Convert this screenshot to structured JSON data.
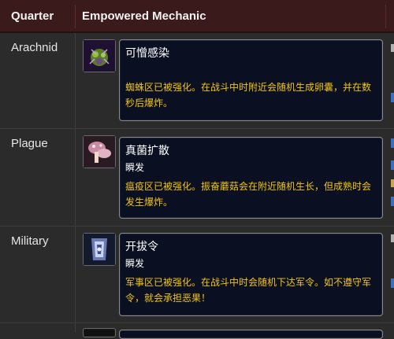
{
  "table": {
    "headers": [
      "Quarter",
      "Empowered Mechanic"
    ],
    "rows": [
      {
        "quarter": "Arachnid",
        "icon": "spider-egg-icon",
        "spell_name": "可憎感染",
        "cast_time": "",
        "description": "蜘蛛区已被强化。在战斗中时附近会随机生成卵囊，并在数秒后爆炸。"
      },
      {
        "quarter": "Plague",
        "icon": "mushroom-icon",
        "spell_name": "真菌扩散",
        "cast_time": "瞬发",
        "description": "瘟疫区已被强化。振奋蘑菇会在附近随机生长，但成熟时会发生爆炸。"
      },
      {
        "quarter": "Military",
        "icon": "horde-banner-icon",
        "spell_name": "开拔令",
        "cast_time": "瞬发",
        "description": "军事区已被强化。在战斗中时会随机下达军令。如不遵守军令，就会承担恶果！"
      }
    ]
  },
  "colors": {
    "header_bg": "#3a1a1a",
    "tooltip_bg": "#0a1022",
    "description_text": "#f2c511"
  }
}
